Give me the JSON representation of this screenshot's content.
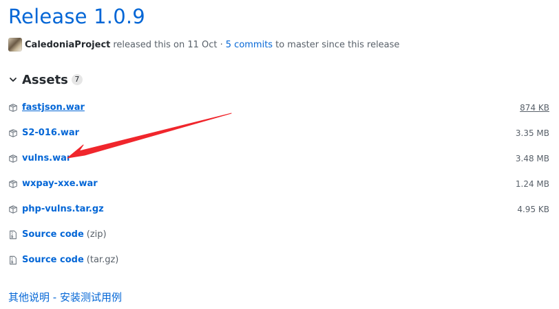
{
  "release": {
    "title": "Release 1.0.9"
  },
  "meta": {
    "author": "CaledoniaProject",
    "released_text": "released this on 11 Oct ·",
    "commits_link": "5 commits",
    "tail_text": "to master since this release"
  },
  "assets": {
    "title": "Assets",
    "count": "7",
    "items": [
      {
        "name": "fastjson.war",
        "suffix": "",
        "size": "874 KB",
        "icon": "package-icon"
      },
      {
        "name": "S2-016.war",
        "suffix": "",
        "size": "3.35 MB",
        "icon": "package-icon"
      },
      {
        "name": "vulns.war",
        "suffix": "",
        "size": "3.48 MB",
        "icon": "package-icon"
      },
      {
        "name": "wxpay-xxe.war",
        "suffix": "",
        "size": "1.24 MB",
        "icon": "package-icon"
      },
      {
        "name": "php-vulns.tar.gz",
        "suffix": "",
        "size": "4.95 KB",
        "icon": "package-icon"
      },
      {
        "name": "Source code",
        "suffix": "(zip)",
        "size": "",
        "icon": "file-zip-icon"
      },
      {
        "name": "Source code",
        "suffix": "(tar.gz)",
        "size": "",
        "icon": "file-zip-icon"
      }
    ]
  },
  "footer": {
    "link": "其他说明 - 安装测试用例"
  },
  "colors": {
    "link": "#0366d6",
    "muted": "#586069",
    "annotation_arrow": "#f0262c"
  }
}
